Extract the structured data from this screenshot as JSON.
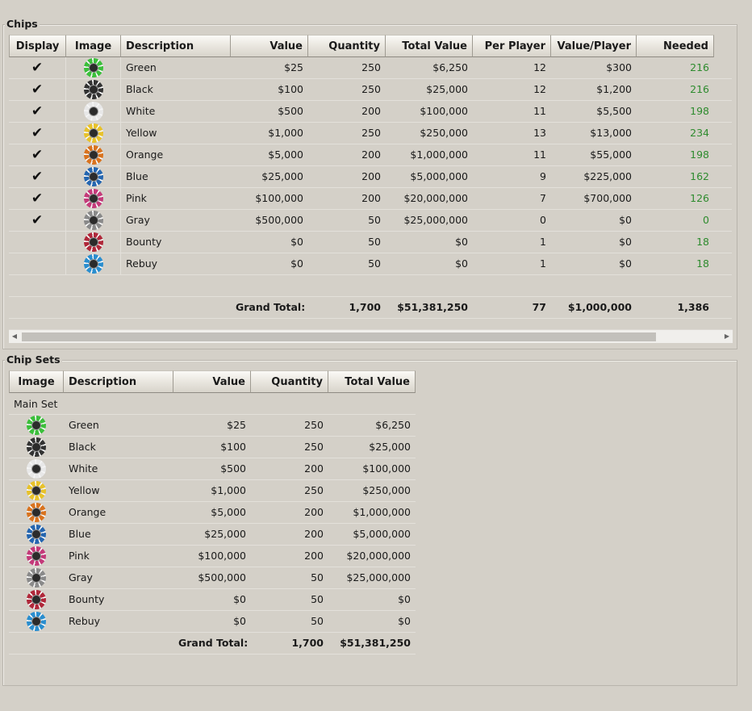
{
  "chips": {
    "title": "Chips",
    "headers": [
      "Display",
      "Image",
      "Description",
      "Value",
      "Quantity",
      "Total Value",
      "Per Player",
      "Value/Player",
      "Needed"
    ],
    "rows": [
      {
        "display": "✔",
        "chip_icon": "green-chip-icon",
        "description": "Green",
        "value": "$25",
        "quantity": "250",
        "total": "$6,250",
        "per_player": "12",
        "value_player": "$300",
        "needed": "216"
      },
      {
        "display": "✔",
        "chip_icon": "black-chip-icon",
        "description": "Black",
        "value": "$100",
        "quantity": "250",
        "total": "$25,000",
        "per_player": "12",
        "value_player": "$1,200",
        "needed": "216"
      },
      {
        "display": "✔",
        "chip_icon": "white-chip-icon",
        "description": "White",
        "value": "$500",
        "quantity": "200",
        "total": "$100,000",
        "per_player": "11",
        "value_player": "$5,500",
        "needed": "198"
      },
      {
        "display": "✔",
        "chip_icon": "yellow-chip-icon",
        "description": "Yellow",
        "value": "$1,000",
        "quantity": "250",
        "total": "$250,000",
        "per_player": "13",
        "value_player": "$13,000",
        "needed": "234"
      },
      {
        "display": "✔",
        "chip_icon": "orange-chip-icon",
        "description": "Orange",
        "value": "$5,000",
        "quantity": "200",
        "total": "$1,000,000",
        "per_player": "11",
        "value_player": "$55,000",
        "needed": "198"
      },
      {
        "display": "✔",
        "chip_icon": "blue-chip-icon",
        "description": "Blue",
        "value": "$25,000",
        "quantity": "200",
        "total": "$5,000,000",
        "per_player": "9",
        "value_player": "$225,000",
        "needed": "162"
      },
      {
        "display": "✔",
        "chip_icon": "pink-chip-icon",
        "description": "Pink",
        "value": "$100,000",
        "quantity": "200",
        "total": "$20,000,000",
        "per_player": "7",
        "value_player": "$700,000",
        "needed": "126"
      },
      {
        "display": "✔",
        "chip_icon": "gray-chip-icon",
        "description": "Gray",
        "value": "$500,000",
        "quantity": "50",
        "total": "$25,000,000",
        "per_player": "0",
        "value_player": "$0",
        "needed": "0"
      },
      {
        "display": "",
        "chip_icon": "bounty-chip-icon",
        "description": "Bounty",
        "value": "$0",
        "quantity": "50",
        "total": "$0",
        "per_player": "1",
        "value_player": "$0",
        "needed": "18"
      },
      {
        "display": "",
        "chip_icon": "rebuy-chip-icon",
        "description": "Rebuy",
        "value": "$0",
        "quantity": "50",
        "total": "$0",
        "per_player": "1",
        "value_player": "$0",
        "needed": "18"
      }
    ],
    "grand_total": {
      "label": "Grand Total:",
      "quantity": "1,700",
      "total": "$51,381,250",
      "per_player": "77",
      "value_player": "$1,000,000",
      "needed": "1,386"
    },
    "chip_colors": [
      "#3bbf3b",
      "#333333",
      "#e8e8e8",
      "#e8c22a",
      "#d9731f",
      "#2566b0",
      "#c43a7a",
      "#8a8a8a",
      "#b0283a",
      "#2a8ecf"
    ],
    "needed_color": "#2e8b2e"
  },
  "chip_sets": {
    "title": "Chip Sets",
    "headers": [
      "Image",
      "Description",
      "Value",
      "Quantity",
      "Total Value"
    ],
    "group_label": "Main Set",
    "rows": [
      {
        "chip_icon": "green-chip-icon",
        "description": "Green",
        "value": "$25",
        "quantity": "250",
        "total": "$6,250"
      },
      {
        "chip_icon": "black-chip-icon",
        "description": "Black",
        "value": "$100",
        "quantity": "250",
        "total": "$25,000"
      },
      {
        "chip_icon": "white-chip-icon",
        "description": "White",
        "value": "$500",
        "quantity": "200",
        "total": "$100,000"
      },
      {
        "chip_icon": "yellow-chip-icon",
        "description": "Yellow",
        "value": "$1,000",
        "quantity": "250",
        "total": "$250,000"
      },
      {
        "chip_icon": "orange-chip-icon",
        "description": "Orange",
        "value": "$5,000",
        "quantity": "200",
        "total": "$1,000,000"
      },
      {
        "chip_icon": "blue-chip-icon",
        "description": "Blue",
        "value": "$25,000",
        "quantity": "200",
        "total": "$5,000,000"
      },
      {
        "chip_icon": "pink-chip-icon",
        "description": "Pink",
        "value": "$100,000",
        "quantity": "200",
        "total": "$20,000,000"
      },
      {
        "chip_icon": "gray-chip-icon",
        "description": "Gray",
        "value": "$500,000",
        "quantity": "50",
        "total": "$25,000,000"
      },
      {
        "chip_icon": "bounty-chip-icon",
        "description": "Bounty",
        "value": "$0",
        "quantity": "50",
        "total": "$0"
      },
      {
        "chip_icon": "rebuy-chip-icon",
        "description": "Rebuy",
        "value": "$0",
        "quantity": "50",
        "total": "$0"
      }
    ],
    "grand_total": {
      "label": "Grand Total:",
      "quantity": "1,700",
      "total": "$51,381,250"
    }
  }
}
